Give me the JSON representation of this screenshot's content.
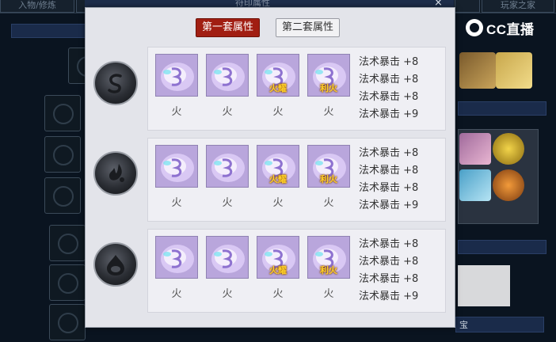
{
  "background": {
    "tabs": [
      "入物/修炼",
      "",
      "",
      "玩家之家"
    ],
    "bottom_label": "宝"
  },
  "logo": {
    "text": "CC直播"
  },
  "popup": {
    "title": "符印属性",
    "close_icon": "×",
    "tabs": [
      {
        "label": "第一套属性",
        "active": true
      },
      {
        "label": "第二套属性",
        "active": false
      }
    ],
    "rows": [
      {
        "rune_icon": "swirl-rune-icon",
        "gems": [
          {
            "name": "火",
            "badge": ""
          },
          {
            "name": "火",
            "badge": ""
          },
          {
            "name": "火",
            "badge": "火耀"
          },
          {
            "name": "火",
            "badge": "利火"
          }
        ],
        "attributes": [
          "法术暴击 +8",
          "法术暴击 +8",
          "法术暴击 +8",
          "法术暴击 +9"
        ]
      },
      {
        "rune_icon": "flame-rune-icon",
        "gems": [
          {
            "name": "火",
            "badge": ""
          },
          {
            "name": "火",
            "badge": ""
          },
          {
            "name": "火",
            "badge": "火耀"
          },
          {
            "name": "火",
            "badge": "利火"
          }
        ],
        "attributes": [
          "法术暴击 +8",
          "法术暴击 +8",
          "法术暴击 +8",
          "法术暴击 +9"
        ]
      },
      {
        "rune_icon": "droplet-rune-icon",
        "gems": [
          {
            "name": "火",
            "badge": ""
          },
          {
            "name": "火",
            "badge": ""
          },
          {
            "name": "火",
            "badge": "火耀"
          },
          {
            "name": "火",
            "badge": "利火"
          }
        ],
        "attributes": [
          "法术暴击 +8",
          "法术暴击 +8",
          "法术暴击 +8",
          "法术暴击 +9"
        ]
      }
    ]
  },
  "colors": {
    "active_tab": "#a11e12",
    "gem_badge": "#ffd02a",
    "popup_bg": "#e3e4ea",
    "game_bg": "#0a1420"
  }
}
